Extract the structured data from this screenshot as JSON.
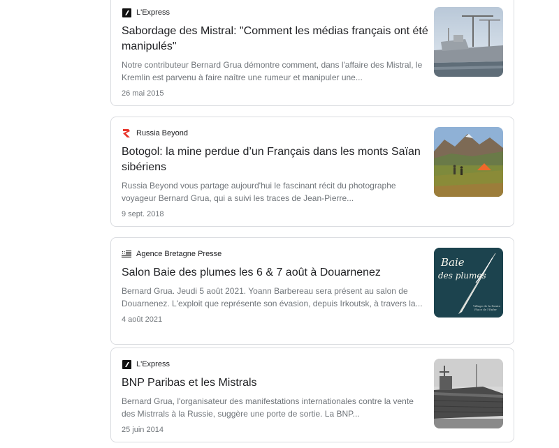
{
  "articles": [
    {
      "source": "L'Express",
      "source_icon": "lexpress-logo-icon",
      "title": "Sabordage des Mistral: \"Comment les médias français ont été manipulés\"",
      "snippet": "Notre contributeur Bernard Grua démontre comment, dans l'affaire des Mistral, le Kremlin est parvenu à faire naître une rumeur et manipuler une...",
      "date": "26 mai 2015",
      "thumbnail": "warship-construction-thumbnail"
    },
    {
      "source": "Russia Beyond",
      "source_icon": "russia-beyond-logo-icon",
      "title": "Botogol: la mine perdue d’un Français dans les monts Saïan sibériens",
      "snippet": "Russia Beyond vous partage aujourd'hui le fascinant récit du photographe voyageur Bernard Grua, qui a suivi les traces de Jean-Pierre...",
      "date": "9 sept. 2018",
      "thumbnail": "mountain-camp-thumbnail"
    },
    {
      "source": "Agence Bretagne Presse",
      "source_icon": "agence-bretagne-presse-flag-icon",
      "title": "Salon Baie des plumes les 6 & 7 août à Douarnenez",
      "snippet": "Bernard Grua. Jeudi 5 août 2021. Yoann Barbereau sera présent au salon de Douarnenez. L'exploit que représente son évasion, depuis Irkoutsk, à travers la...",
      "date": "4 août 2021",
      "thumbnail": "baie-des-plumes-poster-thumbnail",
      "thumbnail_text": {
        "line1": "Baie",
        "line2": "des plumes",
        "caption1": "Village de la Pointe",
        "caption2": "Place de l'Enfer"
      }
    },
    {
      "source": "L'Express",
      "source_icon": "lexpress-logo-icon",
      "title": "BNP Paribas et les Mistrals",
      "snippet": "Bernard Grua, l'organisateur des manifestations internationales contre la vente des Mistrrals à la Russie, suggère une porte de sortie. La BNP...",
      "date": "25 juin 2014",
      "thumbnail": "warship-bw-thumbnail"
    }
  ],
  "colors": {
    "border": "#dadce0",
    "title": "#202124",
    "snippet": "#70757a",
    "russia_beyond_red": "#e8352b"
  }
}
